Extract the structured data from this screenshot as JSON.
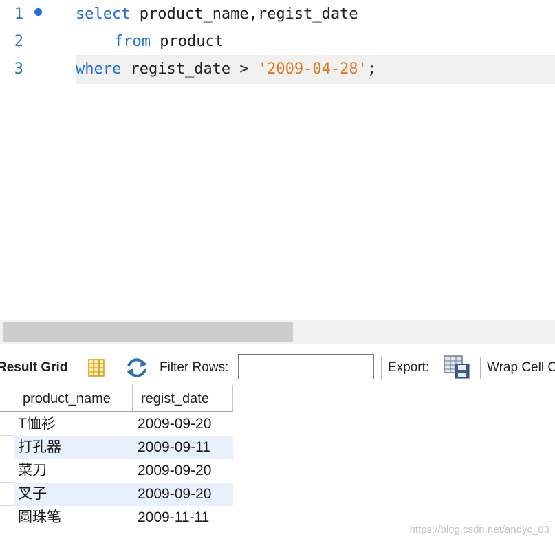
{
  "editor": {
    "lines": [
      {
        "num": "1",
        "tokens": [
          {
            "t": "select",
            "k": "kw"
          },
          {
            "t": " product_name,regist_date",
            "k": "id"
          }
        ]
      },
      {
        "num": "2",
        "tokens": [
          {
            "t": "from",
            "k": "kw"
          },
          {
            "t": " product",
            "k": "id"
          }
        ]
      },
      {
        "num": "3",
        "tokens": [
          {
            "t": "where",
            "k": "kw"
          },
          {
            "t": " regist_date > ",
            "k": "id"
          },
          {
            "t": "'2009-04-28'",
            "k": "str"
          },
          {
            "t": ";",
            "k": "id"
          }
        ]
      }
    ]
  },
  "toolbar": {
    "result_grid_label": "Result Grid",
    "grid_icon": "grid-toggle-icon",
    "refresh_icon": "refresh-icon",
    "filter_label": "Filter Rows:",
    "filter_value": "",
    "export_label": "Export:",
    "export_icon": "export-icon",
    "wrap_label": "Wrap Cell C"
  },
  "grid": {
    "columns": [
      "product_name",
      "regist_date"
    ],
    "rows": [
      [
        "T恤衫",
        "2009-09-20"
      ],
      [
        "打孔器",
        "2009-09-11"
      ],
      [
        "菜刀",
        "2009-09-20"
      ],
      [
        "叉子",
        "2009-09-20"
      ],
      [
        "圆珠笔",
        "2009-11-11"
      ]
    ]
  },
  "watermark": "https://blog.csdn.net/andyc_03",
  "colors": {
    "keyword": "#1f6fd6",
    "string": "#e0771b",
    "line_number": "#2b7bb9",
    "alt_row": "#e8f0fb"
  }
}
